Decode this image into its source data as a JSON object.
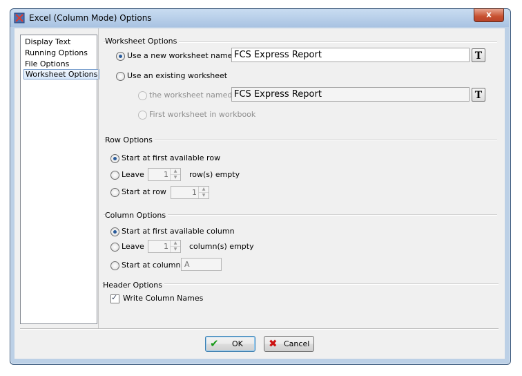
{
  "window": {
    "title": "Excel (Column Mode) Options",
    "close_glyph": "x"
  },
  "nav": {
    "items": [
      {
        "label": "Display Text"
      },
      {
        "label": "Running Options"
      },
      {
        "label": "File Options"
      },
      {
        "label": "Worksheet Options",
        "selected": true
      }
    ]
  },
  "worksheet_options": {
    "heading": "Worksheet Options",
    "new_label": "Use a new worksheet named:",
    "new_value": "FCS Express Report",
    "existing_label": "Use an existing worksheet",
    "named_label": "the worksheet named",
    "named_value": "FCS Express Report",
    "first_label": "First worksheet in workbook",
    "token_button": "T"
  },
  "row_options": {
    "heading": "Row Options",
    "first_label": "Start at first available row",
    "leave_label": "Leave",
    "leave_value": "1",
    "leave_suffix": "row(s) empty",
    "start_label": "Start at row",
    "start_value": "1"
  },
  "column_options": {
    "heading": "Column Options",
    "first_label": "Start at first available column",
    "leave_label": "Leave",
    "leave_value": "1",
    "leave_suffix": "column(s) empty",
    "start_label": "Start at column",
    "start_value": "A"
  },
  "header_options": {
    "heading": "Header Options",
    "write_names_label": "Write Column Names",
    "write_names_checked": true
  },
  "buttons": {
    "ok": "OK",
    "cancel": "Cancel"
  },
  "icons": {
    "ok": "check-icon",
    "cancel": "x-icon",
    "app": "app-icon"
  },
  "colors": {
    "ok_icon": "#1a9a1a",
    "cancel_icon": "#cc1111",
    "selection": "#d6e7fb"
  }
}
